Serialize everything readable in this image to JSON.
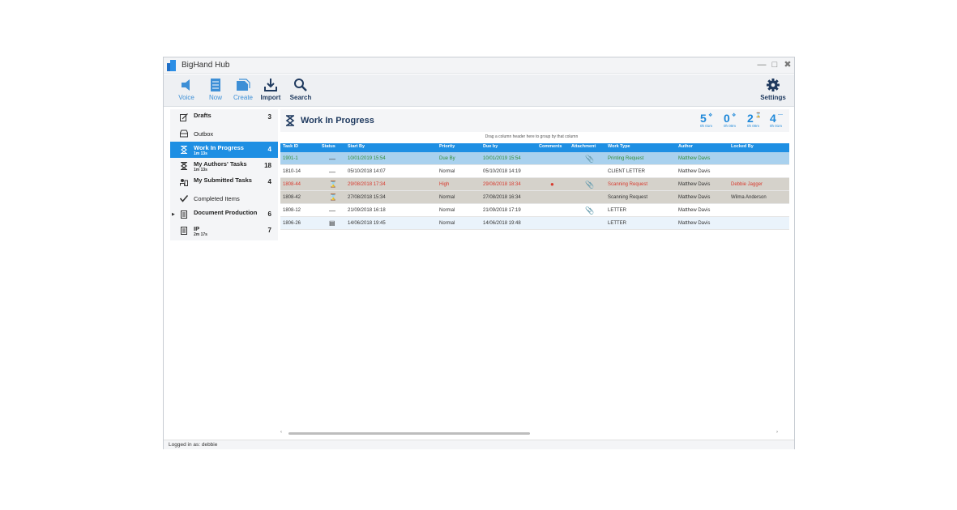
{
  "window": {
    "title": "BigHand Hub"
  },
  "colors": {
    "accent": "#1e8fe3",
    "title_navy": "#1f3a5f",
    "light_blue": "#3d8fd6",
    "green": "#2e8b3a",
    "red": "#d83a2e"
  },
  "toolbar": {
    "items": [
      {
        "label": "Voice",
        "icon": "voice-icon"
      },
      {
        "label": "Now",
        "icon": "now-icon"
      },
      {
        "label": "Create",
        "icon": "create-icon"
      },
      {
        "label": "Import",
        "icon": "import-icon"
      },
      {
        "label": "Search",
        "icon": "search-icon"
      }
    ],
    "settings_label": "Settings"
  },
  "sidebar": {
    "items": [
      {
        "label": "Drafts",
        "count": "3",
        "sub": ""
      },
      {
        "label": "Outbox",
        "count": "",
        "sub": ""
      },
      {
        "label": "Work In Progress",
        "count": "4",
        "sub": "1m 13s"
      },
      {
        "label": "My Authors' Tasks",
        "count": "18",
        "sub": "1m 13s"
      },
      {
        "label": "My Submitted Tasks",
        "count": "4",
        "sub": ""
      },
      {
        "label": "Completed Items",
        "count": "",
        "sub": ""
      },
      {
        "label": "Document Production",
        "count": "6",
        "sub": ""
      },
      {
        "label": "IP",
        "count": "7",
        "sub": "2m 17s"
      }
    ]
  },
  "content": {
    "title": "Work In Progress",
    "group_hint": "Drag a column header here to group by that column",
    "stats": [
      {
        "value": "5",
        "time": "0h 01m"
      },
      {
        "value": "0",
        "time": "0h 00m"
      },
      {
        "value": "2",
        "time": "0h 00m"
      },
      {
        "value": "4",
        "time": "0h 01m"
      }
    ]
  },
  "table": {
    "columns": [
      "Task ID",
      "Status",
      "Start By",
      "Priority",
      "Due by",
      "Comments",
      "Attachment",
      "Work Type",
      "Author",
      "Locked By"
    ],
    "rows": [
      {
        "task_id": "1901-1",
        "start_by": "10/01/2019 15:54",
        "priority": "Due By",
        "due_by": "10/01/2019 15:54",
        "work_type": "Printing Request",
        "author": "Matthew Davis",
        "locked_by": ""
      },
      {
        "task_id": "1810-14",
        "start_by": "05/10/2018 14:07",
        "priority": "Normal",
        "due_by": "05/10/2018 14:19",
        "work_type": "CLIENT LETTER",
        "author": "Matthew Davis",
        "locked_by": ""
      },
      {
        "task_id": "1808-44",
        "start_by": "29/08/2018 17:34",
        "priority": "High",
        "due_by": "29/08/2018 18:34",
        "work_type": "Scanning Request",
        "author": "Matthew Davis",
        "locked_by": "Debbie Jagger"
      },
      {
        "task_id": "1808-42",
        "start_by": "27/08/2018 15:34",
        "priority": "Normal",
        "due_by": "27/08/2018 16:34",
        "work_type": "Scanning Request",
        "author": "Matthew Davis",
        "locked_by": "Wilma Anderson"
      },
      {
        "task_id": "1808-12",
        "start_by": "21/09/2018 16:18",
        "priority": "Normal",
        "due_by": "21/09/2018 17:19",
        "work_type": "LETTER",
        "author": "Matthew Davis",
        "locked_by": ""
      },
      {
        "task_id": "1806-26",
        "start_by": "14/06/2018 19:45",
        "priority": "Normal",
        "due_by": "14/06/2018 19:48",
        "work_type": "LETTER",
        "author": "Matthew Davis",
        "locked_by": ""
      }
    ]
  },
  "status": {
    "text": "Logged in as: debbie"
  }
}
